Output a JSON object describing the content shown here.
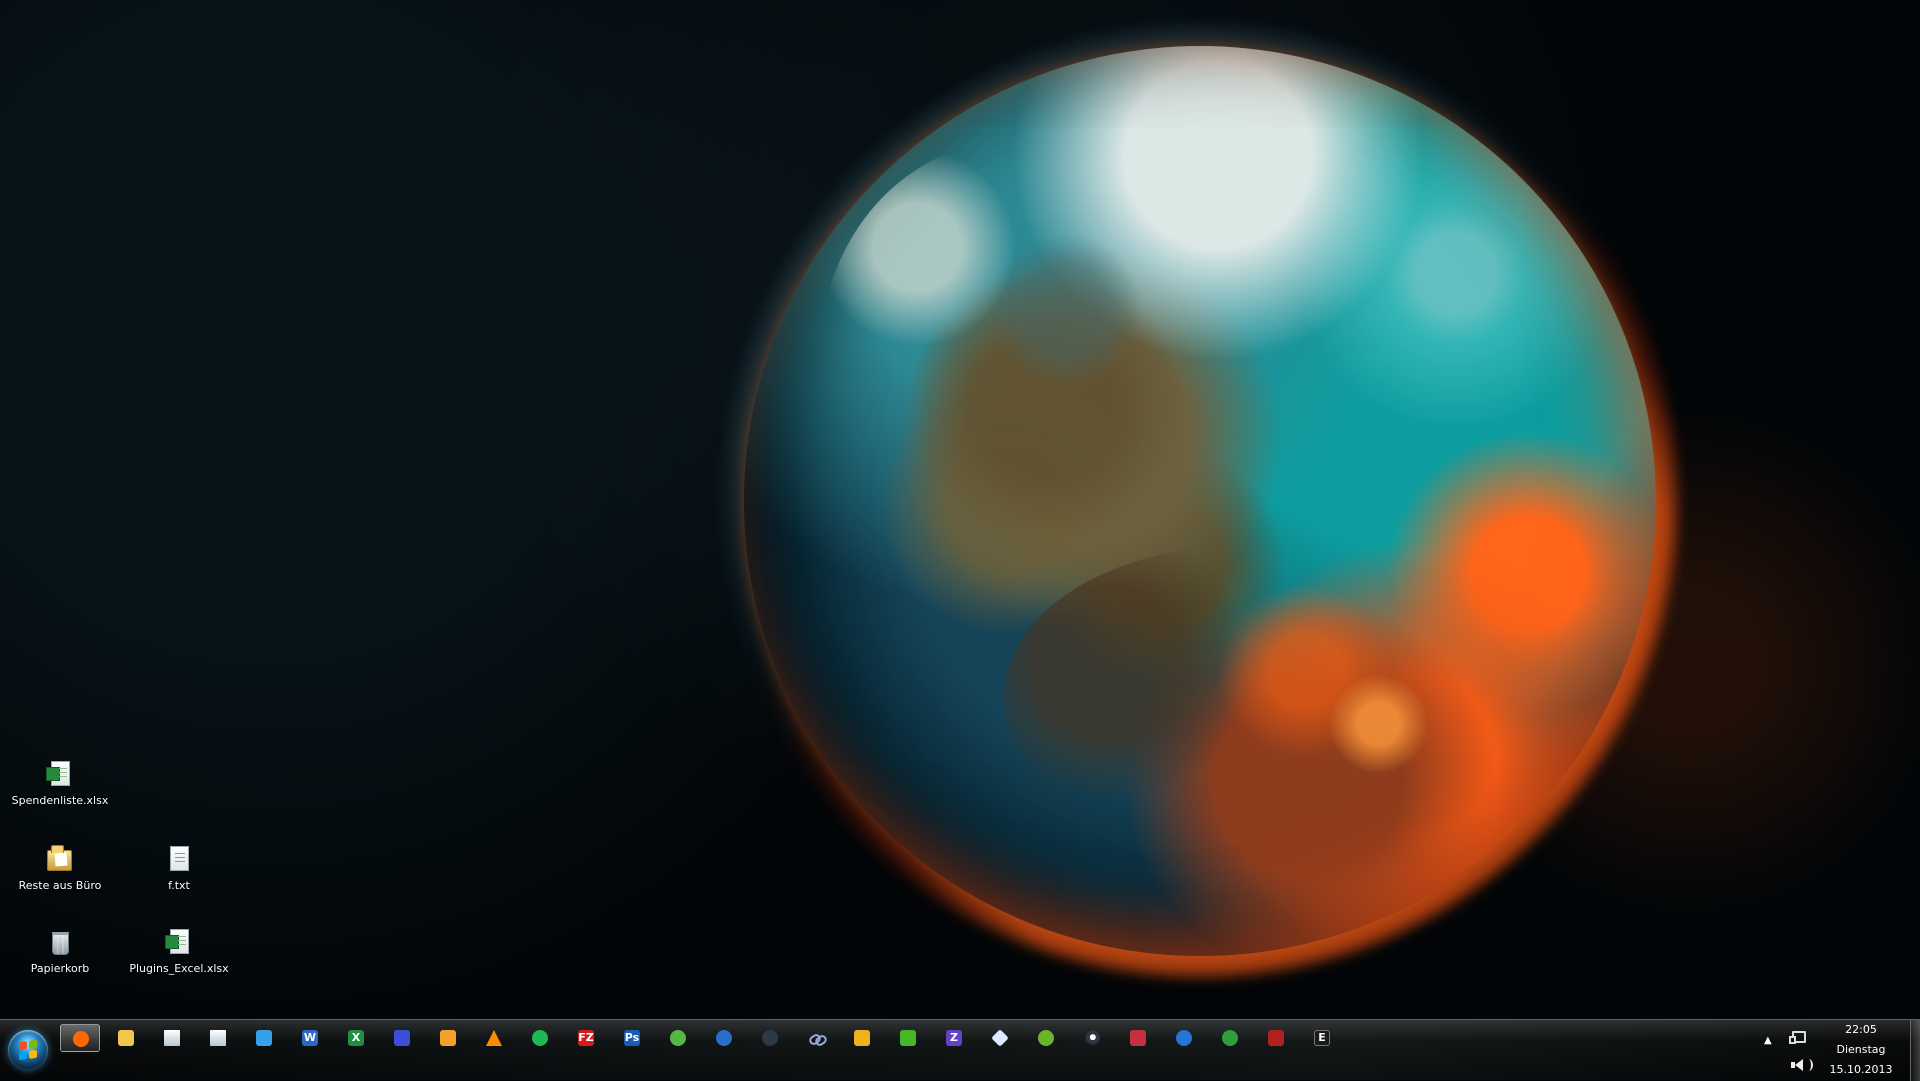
{
  "desktop": {
    "icons": [
      {
        "label": "Spendenliste.xlsx",
        "icon": "excel-file-icon"
      },
      {
        "label": "Reste aus Büro",
        "icon": "folder-icon"
      },
      {
        "label": "f.txt",
        "icon": "text-file-icon"
      },
      {
        "label": "Papierkorb",
        "icon": "recycle-bin-icon"
      },
      {
        "label": "Plugins_Excel.xlsx",
        "icon": "excel-file-icon"
      }
    ]
  },
  "taskbar": {
    "pinned_icons": [
      {
        "name": "firefox-icon",
        "color": "#ff6a00",
        "glyph": ""
      },
      {
        "name": "explorer-icon",
        "color": "#f0c64d",
        "glyph": ""
      },
      {
        "name": "document-icon",
        "color": "#d9e7f6",
        "glyph": ""
      },
      {
        "name": "notes-icon",
        "color": "#dce9f9",
        "glyph": ""
      },
      {
        "name": "browser-icon",
        "color": "#37a0e8",
        "glyph": ""
      },
      {
        "name": "word-icon",
        "color": "#2b68c5",
        "glyph": "W"
      },
      {
        "name": "excel-icon",
        "color": "#1e8f45",
        "glyph": "X"
      },
      {
        "name": "network-app-icon",
        "color": "#3a4fd8",
        "glyph": ""
      },
      {
        "name": "media-player-icon",
        "color": "#f2a12a",
        "glyph": ""
      },
      {
        "name": "vlc-icon",
        "color": "#ff8a00",
        "glyph": ""
      },
      {
        "name": "spotify-icon",
        "color": "#1db954",
        "glyph": ""
      },
      {
        "name": "filezilla-icon",
        "color": "#d71b1b",
        "glyph": "FZ"
      },
      {
        "name": "photoshop-icon",
        "color": "#1c5bb5",
        "glyph": "Ps"
      },
      {
        "name": "utorrent-icon",
        "color": "#54b842",
        "glyph": ""
      },
      {
        "name": "circle-app-icon",
        "color": "#2b6dca",
        "glyph": ""
      },
      {
        "name": "dark-circle-icon",
        "color": "#2d3944",
        "glyph": ""
      },
      {
        "name": "link-icon",
        "color": "#8fb6d2",
        "glyph": ""
      },
      {
        "name": "bittorrent-icon",
        "color": "#efb21f",
        "glyph": ""
      },
      {
        "name": "green-app-icon",
        "color": "#45b829",
        "glyph": ""
      },
      {
        "name": "z-app-icon",
        "color": "#6640c6",
        "glyph": "Z"
      },
      {
        "name": "diamond-app-icon",
        "color": "#dcebff",
        "glyph": ""
      },
      {
        "name": "green-search-icon",
        "color": "#68b52c",
        "glyph": ""
      },
      {
        "name": "steam-icon",
        "color": "#1a1d25",
        "glyph": ""
      },
      {
        "name": "red-app-icon",
        "color": "#c3323b",
        "glyph": ""
      },
      {
        "name": "blue-bolt-icon",
        "color": "#2375d6",
        "glyph": ""
      },
      {
        "name": "green-globe-icon",
        "color": "#2e9f39",
        "glyph": ""
      },
      {
        "name": "red-tools-icon",
        "color": "#b0221b",
        "glyph": ""
      },
      {
        "name": "text-app-icon",
        "color": "#ffffff",
        "glyph": "E"
      }
    ]
  },
  "system_tray": {
    "time": "22:05",
    "day": "Dienstag",
    "date": "15.10.2013"
  }
}
